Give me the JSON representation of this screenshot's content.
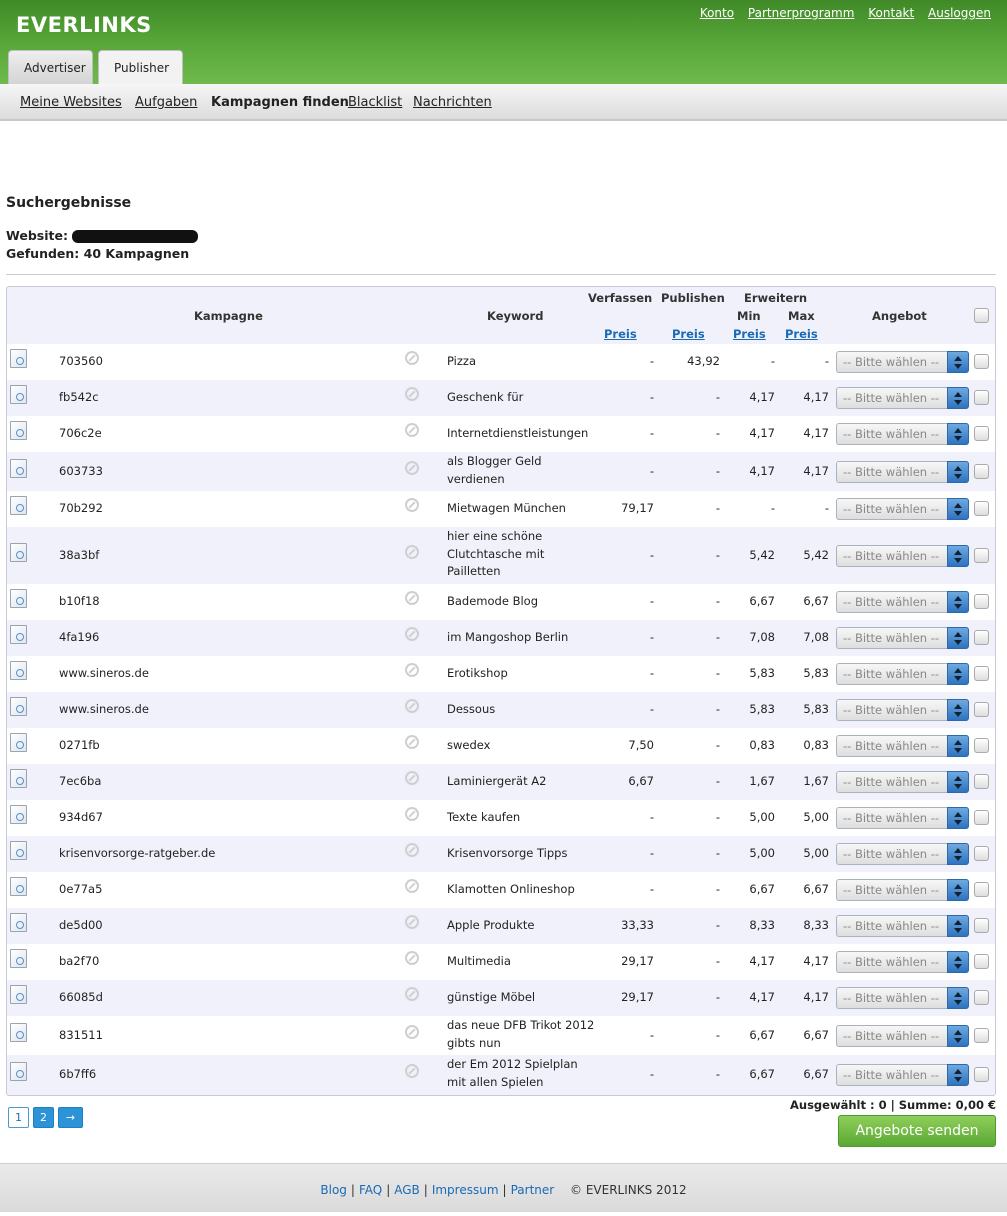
{
  "brand": "EVERLINKS",
  "top_links": [
    "Konto",
    "Partnerprogramm",
    "Kontakt",
    "Ausloggen"
  ],
  "tabs": [
    "Advertiser",
    "Publisher"
  ],
  "subnav": [
    "Meine Websites",
    "Aufgaben",
    "Kampagnen finden",
    "Blacklist",
    "Nachrichten"
  ],
  "results": {
    "heading": "Suchergebnisse",
    "website_label": "Website:",
    "found": "Gefunden: 40 Kampagnen"
  },
  "table": {
    "headers": {
      "kampagne": "Kampagne",
      "keyword": "Keyword",
      "verfassen": "Verfassen",
      "publishen": "Publishen",
      "erweitern": "Erweitern",
      "min": "Min",
      "max": "Max",
      "preis": "Preis",
      "angebot": "Angebot"
    },
    "select_placeholder": "-- Bitte wählen --",
    "rows": [
      {
        "c": "703560",
        "k": "Pizza",
        "v": "-",
        "p": "43,92",
        "mi": "-",
        "ma": "-"
      },
      {
        "c": "fb542c",
        "k": "Geschenk für",
        "v": "-",
        "p": "-",
        "mi": "4,17",
        "ma": "4,17"
      },
      {
        "c": "706c2e",
        "k": "Internetdienstleistungen",
        "v": "-",
        "p": "-",
        "mi": "4,17",
        "ma": "4,17"
      },
      {
        "c": "603733",
        "k": "als Blogger Geld verdienen",
        "v": "-",
        "p": "-",
        "mi": "4,17",
        "ma": "4,17"
      },
      {
        "c": "70b292",
        "k": "Mietwagen München",
        "v": "79,17",
        "p": "-",
        "mi": "-",
        "ma": "-"
      },
      {
        "c": "38a3bf",
        "k": "hier eine schöne Clutchtasche mit Pailletten",
        "v": "-",
        "p": "-",
        "mi": "5,42",
        "ma": "5,42"
      },
      {
        "c": "b10f18",
        "k": "Bademode Blog",
        "v": "-",
        "p": "-",
        "mi": "6,67",
        "ma": "6,67"
      },
      {
        "c": "4fa196",
        "k": "im Mangoshop Berlin",
        "v": "-",
        "p": "-",
        "mi": "7,08",
        "ma": "7,08"
      },
      {
        "c": "www.sineros.de",
        "k": "Erotikshop",
        "v": "-",
        "p": "-",
        "mi": "5,83",
        "ma": "5,83"
      },
      {
        "c": "www.sineros.de",
        "k": "Dessous",
        "v": "-",
        "p": "-",
        "mi": "5,83",
        "ma": "5,83"
      },
      {
        "c": "0271fb",
        "k": "swedex",
        "v": "7,50",
        "p": "-",
        "mi": "0,83",
        "ma": "0,83"
      },
      {
        "c": "7ec6ba",
        "k": "Laminiergerät A2",
        "v": "6,67",
        "p": "-",
        "mi": "1,67",
        "ma": "1,67"
      },
      {
        "c": "934d67",
        "k": "Texte kaufen",
        "v": "-",
        "p": "-",
        "mi": "5,00",
        "ma": "5,00"
      },
      {
        "c": "krisenvorsorge-ratgeber.de",
        "k": "Krisenvorsorge Tipps",
        "v": "-",
        "p": "-",
        "mi": "5,00",
        "ma": "5,00"
      },
      {
        "c": "0e77a5",
        "k": "Klamotten Onlineshop",
        "v": "-",
        "p": "-",
        "mi": "6,67",
        "ma": "6,67"
      },
      {
        "c": "de5d00",
        "k": "Apple Produkte",
        "v": "33,33",
        "p": "-",
        "mi": "8,33",
        "ma": "8,33"
      },
      {
        "c": "ba2f70",
        "k": "Multimedia",
        "v": "29,17",
        "p": "-",
        "mi": "4,17",
        "ma": "4,17"
      },
      {
        "c": "66085d",
        "k": "günstige Möbel",
        "v": "29,17",
        "p": "-",
        "mi": "4,17",
        "ma": "4,17"
      },
      {
        "c": "831511",
        "k": "das neue DFB Trikot 2012 gibts nun",
        "v": "-",
        "p": "-",
        "mi": "6,67",
        "ma": "6,67"
      },
      {
        "c": "6b7ff6",
        "k": "der Em 2012 Spielplan mit allen Spielen",
        "v": "-",
        "p": "-",
        "mi": "6,67",
        "ma": "6,67"
      }
    ]
  },
  "pagination": [
    "1",
    "2",
    "→"
  ],
  "summary": "Ausgewählt : 0 | Summe: 0,00 €",
  "send_button": "Angebote senden",
  "footer": {
    "links": [
      "Blog",
      "FAQ",
      "AGB",
      "Impressum",
      "Partner"
    ],
    "copyright": "© EVERLINKS 2012"
  }
}
